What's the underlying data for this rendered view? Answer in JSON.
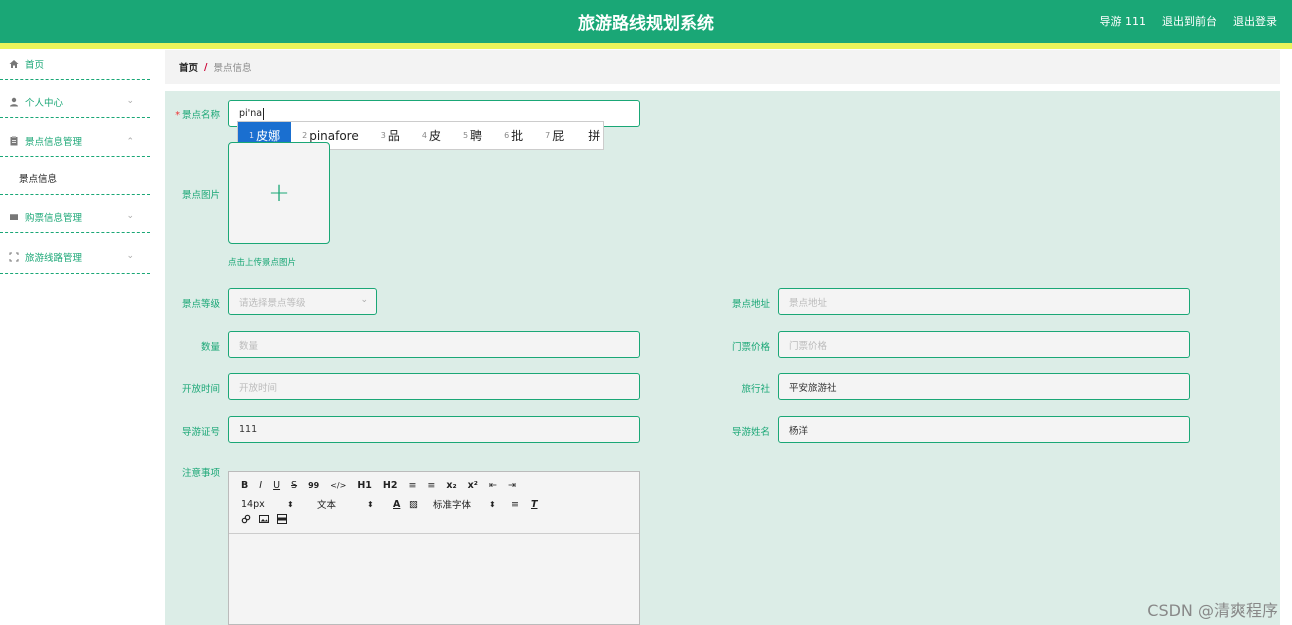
{
  "header": {
    "title": "旅游路线规划系统",
    "user": "导游 111",
    "front_link": "退出到前台",
    "logout": "退出登录"
  },
  "sidebar": {
    "items": [
      {
        "label": "首页",
        "icon": "home-icon"
      },
      {
        "label": "个人中心",
        "icon": "user-icon"
      },
      {
        "label": "景点信息管理",
        "icon": "clipboard-icon"
      },
      {
        "label": "景点信息",
        "icon": ""
      },
      {
        "label": "购票信息管理",
        "icon": "ticket-icon"
      },
      {
        "label": "旅游线路管理",
        "icon": "frame-icon"
      }
    ]
  },
  "breadcrumb": {
    "home": "首页",
    "separator": "/",
    "current": "景点信息"
  },
  "form": {
    "name_label": "景点名称",
    "name_value": "pi'na",
    "image_label": "景点图片",
    "upload_tip": "点击上传景点图片",
    "level_label": "景点等级",
    "level_placeholder": "请选择景点等级",
    "address_label": "景点地址",
    "address_placeholder": "景点地址",
    "count_label": "数量",
    "count_placeholder": "数量",
    "price_label": "门票价格",
    "price_placeholder": "门票价格",
    "open_label": "开放时间",
    "open_placeholder": "开放时间",
    "agency_label": "旅行社",
    "agency_value": "平安旅游社",
    "guide_id_label": "导游证号",
    "guide_id_value": "111",
    "guide_name_label": "导游姓名",
    "guide_name_value": "杨洋",
    "notes_label": "注意事项"
  },
  "ime": {
    "candidates": [
      {
        "n": "1",
        "t": "皮娜"
      },
      {
        "n": "2",
        "t": "pinafore"
      },
      {
        "n": "3",
        "t": "品"
      },
      {
        "n": "4",
        "t": "皮"
      },
      {
        "n": "5",
        "t": "聘"
      },
      {
        "n": "6",
        "t": "批"
      },
      {
        "n": "7",
        "t": "屁"
      },
      {
        "n": "",
        "t": "拼"
      }
    ]
  },
  "editor": {
    "row1": [
      "B",
      "I",
      "U",
      "S",
      "99",
      "</>",
      "H1",
      "H2",
      "≡",
      "≡",
      "x₂",
      "x²",
      "⇤",
      "⇥"
    ],
    "size": "14px",
    "block": "文本",
    "font": "标准字体",
    "row3": [
      "🔗",
      "▣",
      "▤"
    ]
  },
  "watermark": "CSDN @清爽程序",
  "colors": {
    "accent": "#1aa776",
    "highlight": "#e9f45a",
    "content_bg": "#dcede7"
  }
}
